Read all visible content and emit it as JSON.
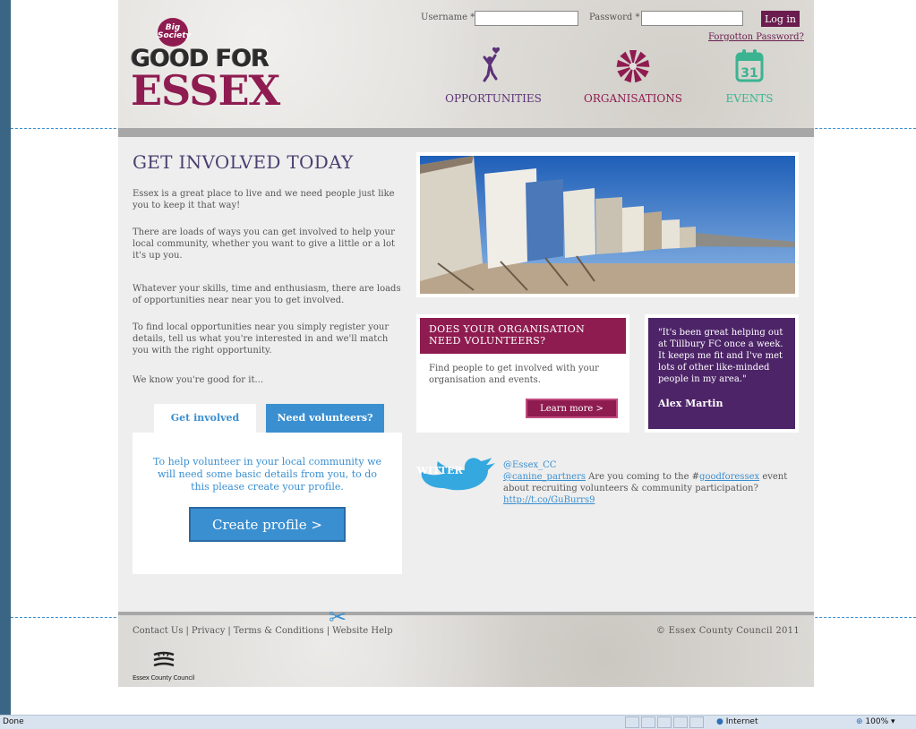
{
  "header": {
    "logo": {
      "badge": "Big Society",
      "line1": "GOOD FOR",
      "line2": "ESSEX"
    },
    "login": {
      "username_label": "Username *",
      "password_label": "Password *",
      "button": "Log in",
      "forgot": "Forgotton Password?"
    },
    "nav": [
      {
        "label": "OPPORTUNITIES",
        "icon": "person-heart-icon",
        "color": "#5b3278"
      },
      {
        "label": "ORGANISATIONS",
        "icon": "swirl-icon",
        "color": "#8f1c50"
      },
      {
        "label": "EVENTS",
        "icon": "calendar-icon",
        "color": "#3bb391",
        "calendar_day": "31"
      }
    ]
  },
  "main": {
    "title": "GET INVOLVED TODAY",
    "paragraphs": [
      "Essex is a great place to live and we need people just like you to keep it that way!",
      "There are loads of ways you can get involved to help your local community, whether you want to give a little or a lot it's up you.",
      "Whatever your skills, time and enthusiasm, there are loads of opportunities near near you to get involved.",
      "To find local opportunities near you simply register your details, tell us what you're interested in and we'll match you with the right opportunity.",
      "We know you're good for it..."
    ],
    "tabs": [
      {
        "label": "Get involved"
      },
      {
        "label": "Need volunteers?"
      }
    ],
    "tab_text": "To help volunteer in your local community we will need some basic details from you, to do this please create your profile.",
    "create_button": "Create profile >",
    "org_panel": {
      "title": "DOES YOUR ORGANISATION NEED VOLUNTEERS?",
      "text": "Find people to get involved with your organisation and events.",
      "button": "Learn more >"
    },
    "quote": {
      "text": "\"It's been great helping out at Tillbury FC once a week. It keeps me fit and I've met lots of other like-minded people in my area.\"",
      "author": "Alex Martin"
    },
    "twitter": {
      "logo_text": "TWITTER",
      "handle": "@Essex_CC",
      "mention": "@canine_partners",
      "text_before": " Are you coming to the #",
      "hashtag": "goodforessex",
      "text_after": " event about recruiting volunteers & community participation?",
      "link": "http://t.co/GuBurrs9"
    }
  },
  "footer": {
    "links": [
      "Contact Us",
      "Privacy",
      "Terms & Conditions",
      "Website Help"
    ],
    "separator": "|",
    "copyright": "© Essex County Council 2011",
    "ecc_logo_text": "Essex County Council"
  },
  "statusbar": {
    "status": "Done",
    "zone": "Internet",
    "zoom": "100%"
  },
  "colors": {
    "brand_purple": "#8f1c50",
    "brand_violet": "#4d2468",
    "accent_blue": "#3a8fd0",
    "events_green": "#3bb391"
  }
}
